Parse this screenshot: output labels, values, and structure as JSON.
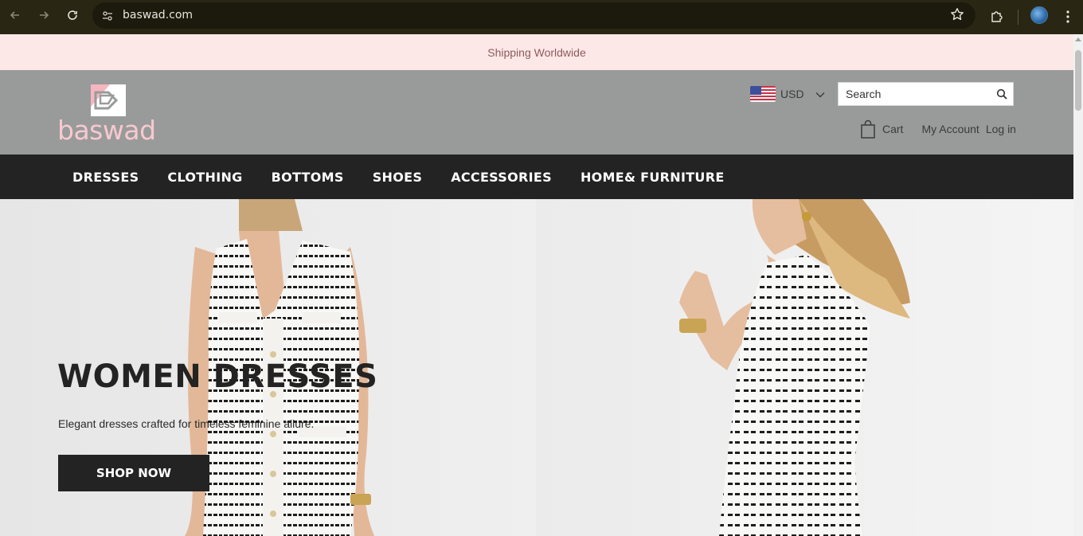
{
  "browser": {
    "url": "baswad.com",
    "icons": {
      "back": "back-arrow-icon",
      "forward": "forward-arrow-icon",
      "reload": "reload-icon",
      "site_info": "site-settings-icon",
      "bookmark": "star-icon",
      "extensions": "puzzle-icon",
      "profile": "avatar",
      "menu": "kebab-menu-icon"
    }
  },
  "announcement": {
    "text": "Shipping Worldwide"
  },
  "header": {
    "logo_text": "baswad",
    "currency": {
      "code": "USD",
      "flag": "us-flag-icon"
    },
    "search": {
      "placeholder": "Search"
    },
    "cart_label": "Cart",
    "my_account_label": "My Account",
    "login_label": "Log in"
  },
  "nav": {
    "items": [
      "DRESSES",
      "CLOTHING",
      "BOTTOMS",
      "SHOES",
      "ACCESSORIES",
      "HOME& FURNITURE"
    ]
  },
  "hero": {
    "title": "WOMEN DRESSES",
    "subtitle": "Elegant dresses crafted for timeless feminine allure.",
    "cta_label": "SHOP NOW"
  },
  "colors": {
    "chrome": "#2a2614",
    "announce_bg": "#fde8e8",
    "header_bg": "#999b9a",
    "nav_bg": "#232323",
    "logo_pink": "#f7c9d0"
  }
}
